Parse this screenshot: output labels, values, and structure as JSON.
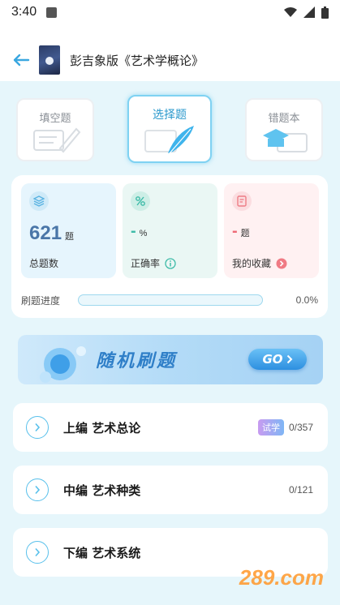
{
  "status_bar": {
    "time": "3:40"
  },
  "header": {
    "title": "彭吉象版《艺术学概论》"
  },
  "modes": [
    {
      "label": "填空题",
      "active": false
    },
    {
      "label": "选择题",
      "active": true
    },
    {
      "label": "错题本",
      "active": false
    }
  ],
  "stats": {
    "total": {
      "value": "621",
      "unit": "题",
      "label": "总题数"
    },
    "accuracy": {
      "value": "-",
      "unit": "%",
      "label": "正确率"
    },
    "favorites": {
      "value": "-",
      "unit": "题",
      "label": "我的收藏"
    }
  },
  "progress": {
    "label": "刷题进度",
    "value_text": "0.0%",
    "fraction": 0.0
  },
  "banner": {
    "text": "随机刷题",
    "button": "GO"
  },
  "chapters": [
    {
      "title": "上编 艺术总论",
      "badge": "试学",
      "count": "0/357"
    },
    {
      "title": "中编 艺术种类",
      "badge": "",
      "count": "0/121"
    },
    {
      "title": "下编 艺术系统",
      "badge": "",
      "count": ""
    }
  ],
  "watermark": "289.com",
  "colors": {
    "accent": "#2a98cc",
    "panel_bg": "#e6f6fb",
    "favorites_bg": "#fff1f2",
    "accuracy_bg": "#eaf7f4",
    "total_bg": "#e6f5fd"
  }
}
